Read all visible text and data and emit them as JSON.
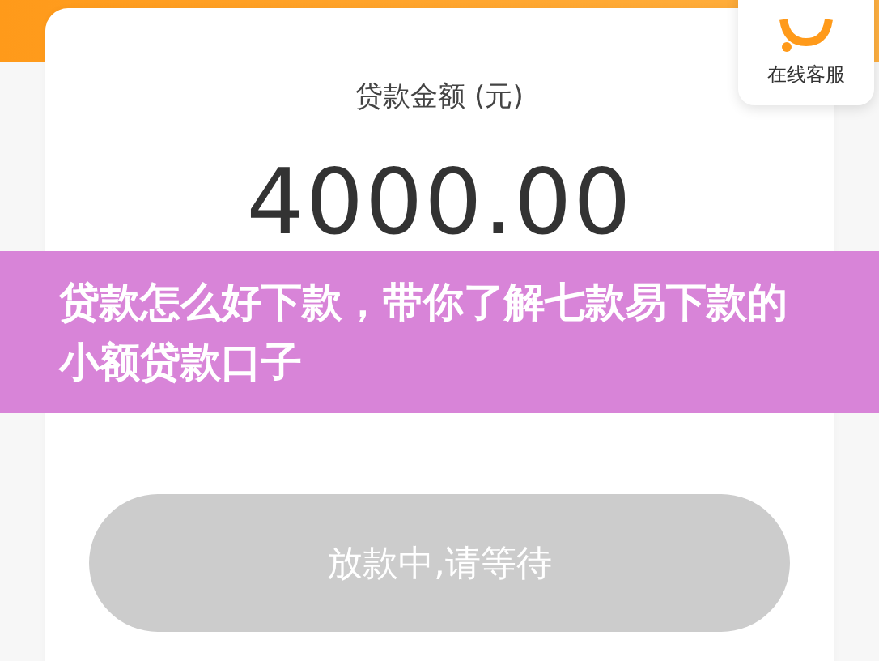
{
  "customer_service": {
    "label": "在线客服"
  },
  "loan": {
    "label": "贷款金额 (元)",
    "amount": "4000.00"
  },
  "status_button": {
    "label": "放款中,请等待",
    "disabled": true
  },
  "banner": {
    "title": "贷款怎么好下款，带你了解七款易下款的小额贷款口子"
  }
}
